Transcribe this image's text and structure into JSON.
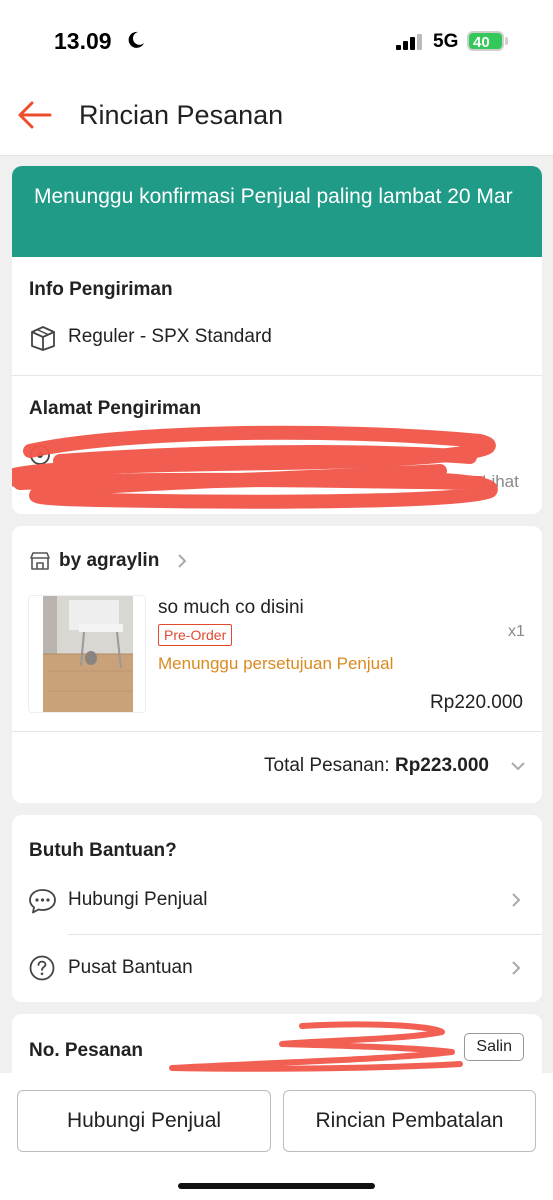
{
  "status_bar": {
    "time": "13.09",
    "network": "5G",
    "battery": "40"
  },
  "header": {
    "title": "Rincian Pesanan"
  },
  "banner": {
    "text": "Menunggu konfirmasi Penjual paling lambat 20 Mar"
  },
  "shipping": {
    "title": "Info Pengiriman",
    "method": "Reguler - SPX Standard",
    "address_title": "Alamat Pengiriman",
    "address_more": "Lihat"
  },
  "order": {
    "shop_name": "by agraylin",
    "product_name": "so much co disini",
    "badge": "Pre-Order",
    "status": "Menunggu persetujuan Penjual",
    "quantity": "x1",
    "price": "Rp220.000",
    "total_label": "Total Pesanan:",
    "total_value": "Rp223.000"
  },
  "help": {
    "title": "Butuh Bantuan?",
    "items": [
      {
        "label": "Hubungi Penjual",
        "icon": "chat-icon"
      },
      {
        "label": "Pusat Bantuan",
        "icon": "question-icon"
      }
    ]
  },
  "order_number": {
    "label": "No. Pesanan",
    "copy_label": "Salin"
  },
  "bottom_actions": {
    "contact_seller": "Hubungi Penjual",
    "cancel_details": "Rincian Pembatalan"
  },
  "colors": {
    "accent": "#ee4d2d",
    "banner": "#1f9b87",
    "status_orange": "#d98a1f",
    "redact": "#f0574a"
  }
}
